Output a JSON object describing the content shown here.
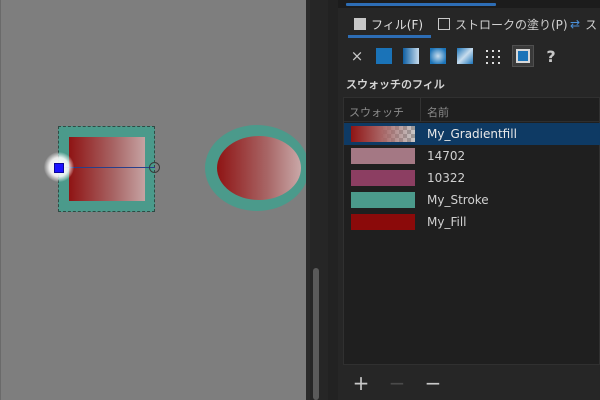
{
  "tabs": {
    "fill_label": "フィル(F)",
    "stroke_label": "ストロークの塗り(P)",
    "more_label": "ス"
  },
  "toolbar": {
    "buttons": [
      {
        "name": "none",
        "icon": "x-icon",
        "glyph": "×"
      },
      {
        "name": "solid",
        "icon": "flat-color-icon"
      },
      {
        "name": "linear",
        "icon": "linear-gradient-icon"
      },
      {
        "name": "radial",
        "icon": "radial-gradient-icon"
      },
      {
        "name": "conic",
        "icon": "mesh-gradient-icon"
      },
      {
        "name": "pattern",
        "icon": "pattern-icon"
      },
      {
        "name": "swatch",
        "icon": "swatch-icon",
        "selected": true
      },
      {
        "name": "unset",
        "icon": "help-icon",
        "glyph": "?"
      }
    ]
  },
  "section": {
    "title": "スウォッチのフィル"
  },
  "list": {
    "header_swatch": "スウォッチ",
    "header_name": "名前",
    "rows": [
      {
        "label": "My_Gradientfill",
        "color": "#8f1414",
        "selected": true,
        "kind": "gradient"
      },
      {
        "label": "14702",
        "color": "#a47884",
        "selected": false,
        "kind": "solid"
      },
      {
        "label": "10322",
        "color": "#8c3e62",
        "selected": false,
        "kind": "solid"
      },
      {
        "label": "My_Stroke",
        "color": "#4b9a8b",
        "selected": false,
        "kind": "solid"
      },
      {
        "label": "My_Fill",
        "color": "#8b0a0a",
        "selected": false,
        "kind": "solid"
      }
    ]
  },
  "bottom": {
    "add_glyph": "+",
    "remove_glyph": "−",
    "minus_glyph": "−"
  },
  "colors": {
    "accent": "#2d6db5",
    "stroke_teal": "#4b9a8b",
    "fill_red": "#8f1414",
    "selection": "#0e3a64"
  }
}
